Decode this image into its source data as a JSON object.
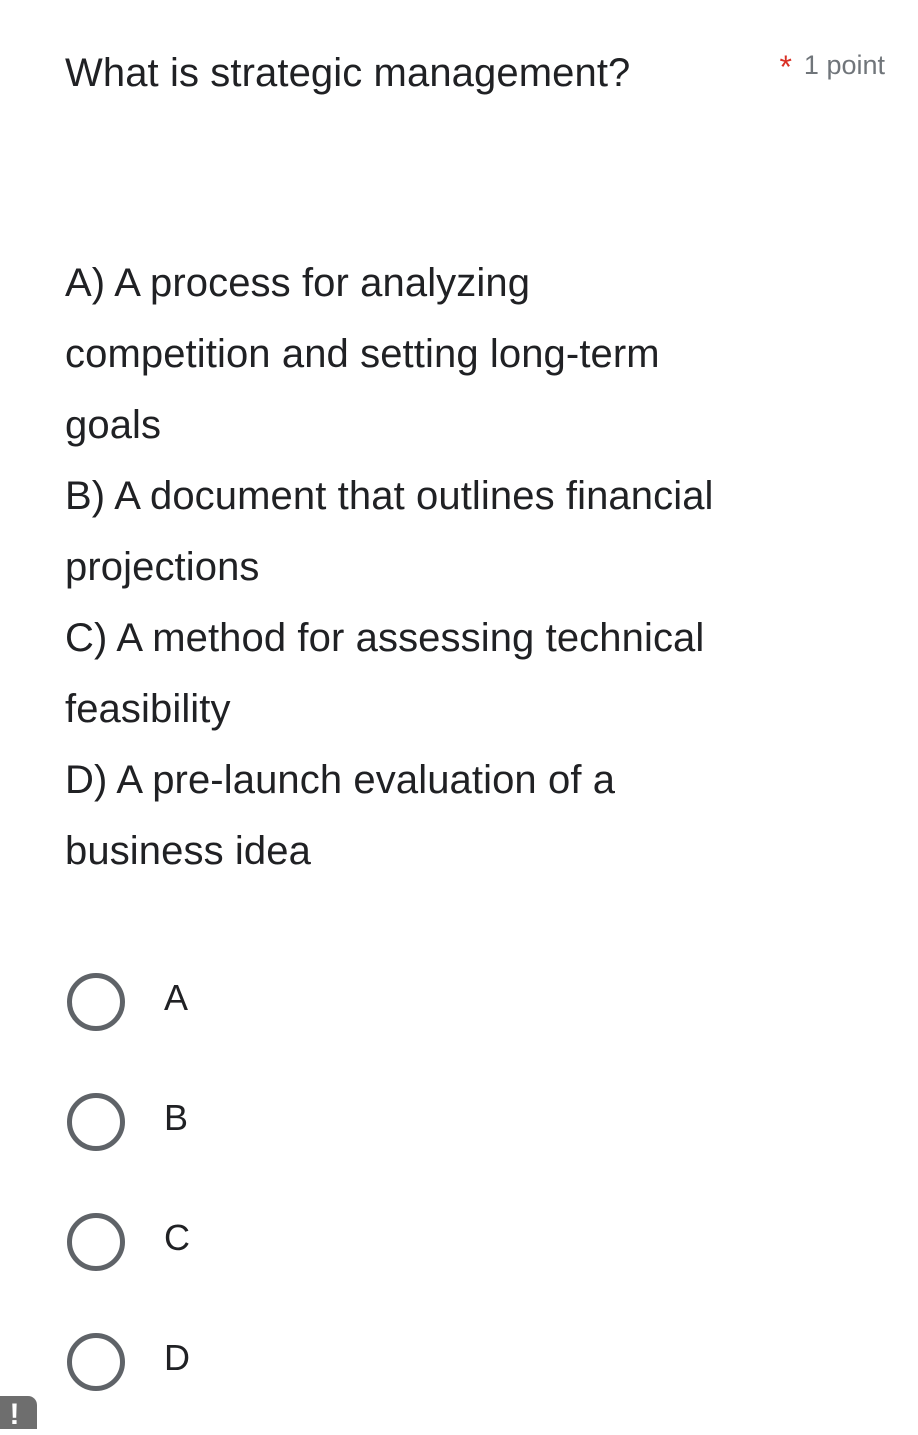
{
  "question": {
    "title": "What is strategic management?",
    "required_marker": "*",
    "points_label": "1 point",
    "description": "A) A process for analyzing competition and setting long-term goals\nB) A document that outlines financial projections\nC) A method for assessing technical feasibility\nD) A pre-launch evaluation of a business idea",
    "options": [
      {
        "label": "A",
        "selected": false
      },
      {
        "label": "B",
        "selected": false
      },
      {
        "label": "C",
        "selected": false
      },
      {
        "label": "D",
        "selected": false
      }
    ]
  },
  "overlay": {
    "badge_glyph": "!"
  },
  "colors": {
    "text": "#202124",
    "muted": "#70757a",
    "required": "#d93025",
    "radio_border": "#5f6368",
    "badge_bg": "#6e6e6e",
    "background": "#ffffff"
  }
}
